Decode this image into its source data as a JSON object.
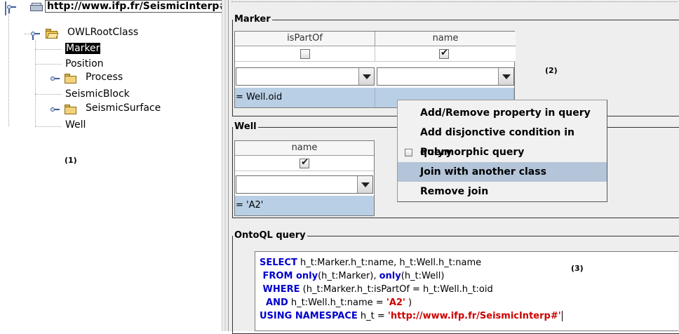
{
  "tree": {
    "root_label": "http://www.ifp.fr/SeismicInterp#",
    "items": [
      {
        "label": "OWLRootClass",
        "level": 1,
        "type": "folder-open"
      },
      {
        "label": "Marker",
        "level": 2,
        "type": "leaf",
        "selected": true
      },
      {
        "label": "Position",
        "level": 2,
        "type": "leaf"
      },
      {
        "label": "Process",
        "level": 2,
        "type": "folder-collapsed"
      },
      {
        "label": "SeismicBlock",
        "level": 2,
        "type": "leaf"
      },
      {
        "label": "SeismicSurface",
        "level": 2,
        "type": "folder-collapsed"
      },
      {
        "label": "Well",
        "level": 2,
        "type": "leaf"
      }
    ],
    "annotation": "(1)"
  },
  "marker_group": {
    "title": "Marker",
    "columns": [
      {
        "header": "isPartOf",
        "checked": false,
        "combo_value": "",
        "condition": "= Well.oid"
      },
      {
        "header": "name",
        "checked": true,
        "combo_value": "",
        "condition": ""
      }
    ],
    "annotation": "(2)"
  },
  "well_group": {
    "title": "Well",
    "columns": [
      {
        "header": "name",
        "checked": true,
        "combo_value": "",
        "condition": "= 'A2'"
      }
    ]
  },
  "context_menu": {
    "items": [
      {
        "label": "Add/Remove property in query",
        "highlighted": false,
        "checkbox": false
      },
      {
        "label": "Add disjonctive condition in query",
        "highlighted": false,
        "checkbox": false
      },
      {
        "label": "Polymorphic query",
        "highlighted": false,
        "checkbox": true,
        "checked": false
      },
      {
        "label": "Join with another class",
        "highlighted": true,
        "checkbox": false
      },
      {
        "label": "Remove join",
        "highlighted": false,
        "checkbox": false
      }
    ]
  },
  "query_group": {
    "title": "OntoQL query",
    "annotation": "(3)",
    "lines": [
      [
        {
          "t": "SELECT",
          "k": "kw"
        },
        {
          "t": " h_t:Marker.h_t:name, h_t:Well.h_t:name",
          "k": "txt"
        }
      ],
      [
        {
          "t": " FROM ",
          "k": "kw"
        },
        {
          "t": "only",
          "k": "kw"
        },
        {
          "t": "(h_t:Marker), ",
          "k": "txt"
        },
        {
          "t": "only",
          "k": "kw"
        },
        {
          "t": "(h_t:Well)",
          "k": "txt"
        }
      ],
      [
        {
          "t": " WHERE",
          "k": "kw"
        },
        {
          "t": " (h_t:Marker.h_t:isPartOf = h_t:Well.h_t:oid",
          "k": "txt"
        }
      ],
      [
        {
          "t": "  AND",
          "k": "kw"
        },
        {
          "t": " h_t:Well.h_t:name = ",
          "k": "txt"
        },
        {
          "t": "'A2'",
          "k": "str"
        },
        {
          "t": " )",
          "k": "txt"
        }
      ],
      [
        {
          "t": "USING NAMESPACE",
          "k": "kw"
        },
        {
          "t": " h_t = ",
          "k": "txt"
        },
        {
          "t": "'http://www.ifp.fr/SeismicInterp#'",
          "k": "str"
        }
      ]
    ]
  },
  "colors": {
    "keyword": "#0000cc",
    "string": "#cc0000",
    "condition_bg": "#b9cfe5",
    "menu_highlight": "#b4c5d9"
  }
}
